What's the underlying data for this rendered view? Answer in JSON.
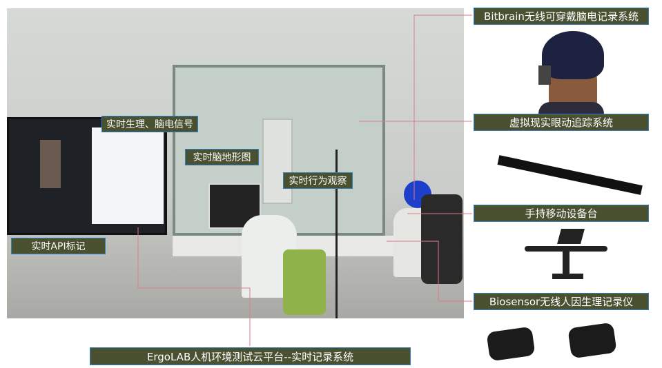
{
  "photo_labels": {
    "physio_eeg": "实时生理、脑电信号",
    "topomap": "实时脑地形图",
    "behavior": "实时行为观察",
    "api": "实时API标记"
  },
  "devices": [
    {
      "label": "Bitbrain无线可穿戴脑电记录系统"
    },
    {
      "label": "虚拟现实眼动追踪系统"
    },
    {
      "label": "手持移动设备台"
    },
    {
      "label": "Biosensor无线人因生理记录仪"
    }
  ],
  "platform": {
    "label": "ErgoLAB人机环境测试云平台--实时记录系统"
  },
  "colors": {
    "label_bg": "#4a5131",
    "label_border": "#2f7fc1",
    "connector": "#e07a8a"
  }
}
